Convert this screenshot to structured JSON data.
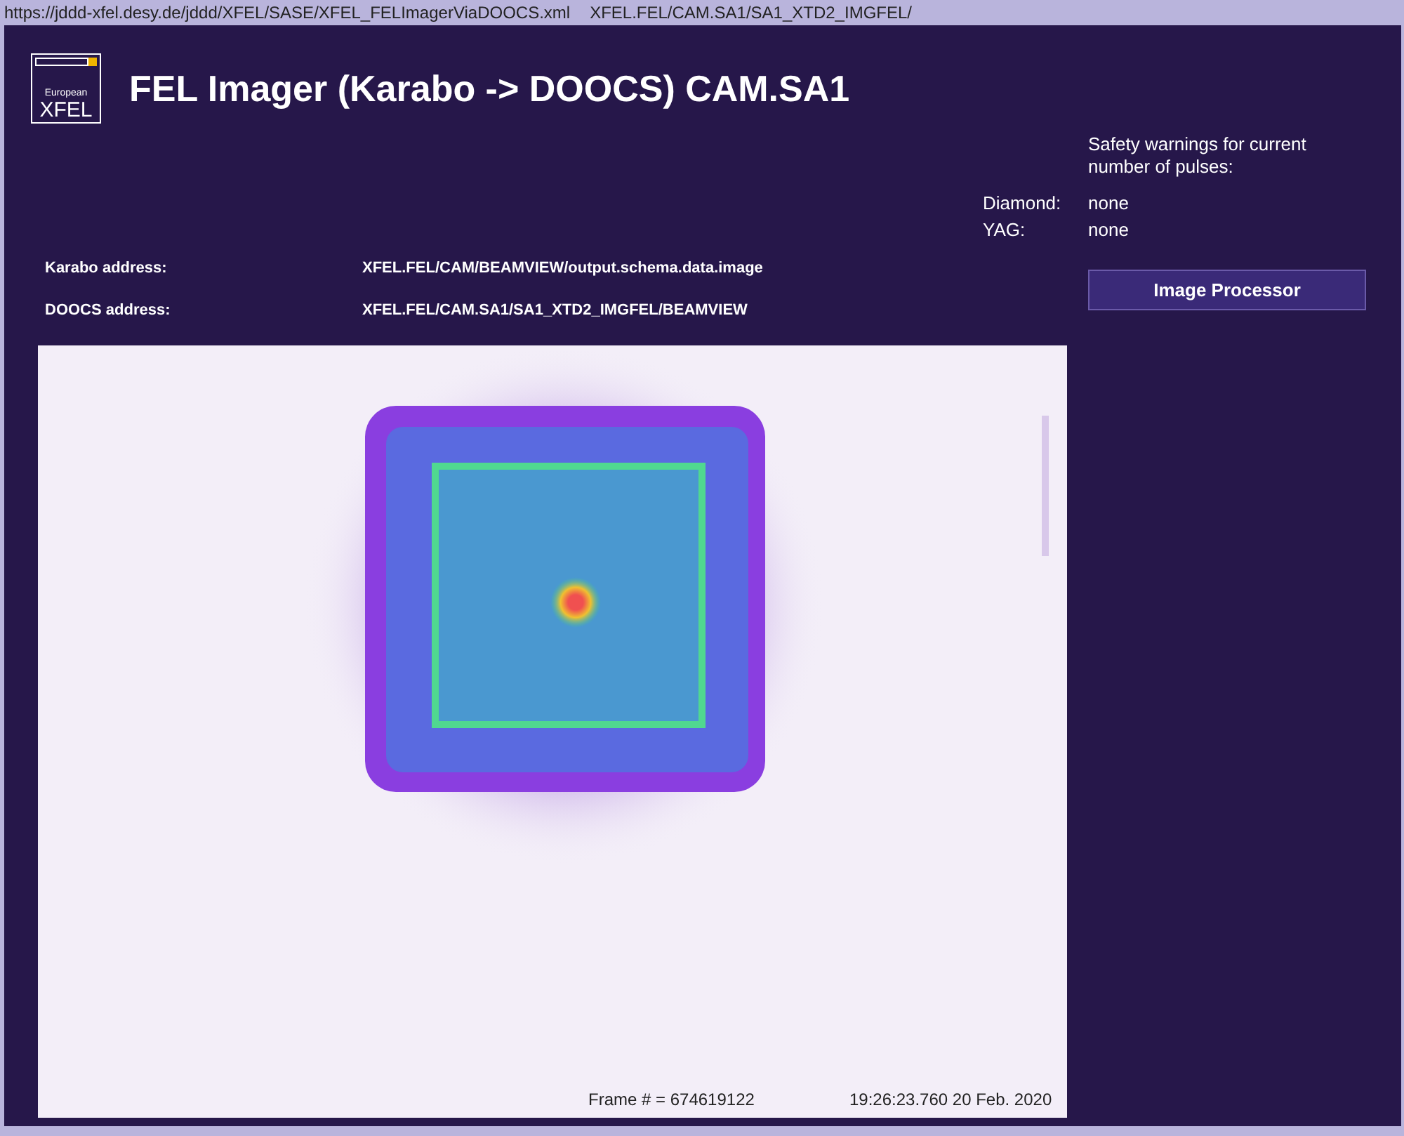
{
  "address_bar": {
    "url": "https://jddd-xfel.desy.de/jddd/XFEL/SASE/XFEL_FELImagerViaDOOCS.xml",
    "device": "XFEL.FEL/CAM.SA1/SA1_XTD2_IMGFEL/"
  },
  "logo": {
    "line_1": "European",
    "line_2": "XFEL"
  },
  "title": "FEL Imager (Karabo -> DOOCS) CAM.SA1",
  "addresses": [
    {
      "label": "Karabo address:",
      "value": "XFEL.FEL/CAM/BEAMVIEW/output.schema.data.image"
    },
    {
      "label": "DOOCS address:",
      "value": "XFEL.FEL/CAM.SA1/SA1_XTD2_IMGFEL/BEAMVIEW"
    }
  ],
  "safety": {
    "heading": "Safety warnings for current number of pulses:",
    "warnings": [
      {
        "label": "Diamond:",
        "value": "none"
      },
      {
        "label": "YAG:",
        "value": "none"
      }
    ]
  },
  "button": "Image Processor",
  "image": {
    "frame": "Frame # = 674619122",
    "timestamp": "19:26:23.760 20 Feb. 2020"
  }
}
